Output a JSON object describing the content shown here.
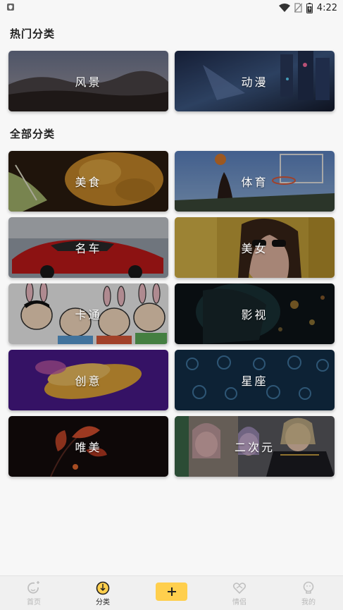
{
  "status_bar": {
    "time": "4:22",
    "icons": [
      "shield-icon",
      "wifi-icon",
      "no-sim-icon",
      "battery-icon"
    ]
  },
  "sections": {
    "hot_title": "热门分类",
    "all_title": "全部分类"
  },
  "hot_categories": [
    {
      "label": "风景",
      "theme": "landscape"
    },
    {
      "label": "动漫",
      "theme": "anime"
    }
  ],
  "all_categories": [
    {
      "label": "美食",
      "theme": "food"
    },
    {
      "label": "体育",
      "theme": "sports"
    },
    {
      "label": "名车",
      "theme": "car"
    },
    {
      "label": "美女",
      "theme": "beauty"
    },
    {
      "label": "卡通",
      "theme": "cartoon"
    },
    {
      "label": "影视",
      "theme": "film"
    },
    {
      "label": "创意",
      "theme": "creative"
    },
    {
      "label": "星座",
      "theme": "zodiac"
    },
    {
      "label": "唯美",
      "theme": "aesthetic"
    },
    {
      "label": "二次元",
      "theme": "acg"
    }
  ],
  "bottom_nav": {
    "items": [
      {
        "label": "首页",
        "icon": "home-icon"
      },
      {
        "label": "分类",
        "icon": "category-icon"
      },
      {
        "label": "",
        "icon": "plus-icon"
      },
      {
        "label": "情侣",
        "icon": "couple-icon"
      },
      {
        "label": "我的",
        "icon": "profile-icon"
      }
    ],
    "active": "分类",
    "accent_color": "#ffcf4d"
  }
}
